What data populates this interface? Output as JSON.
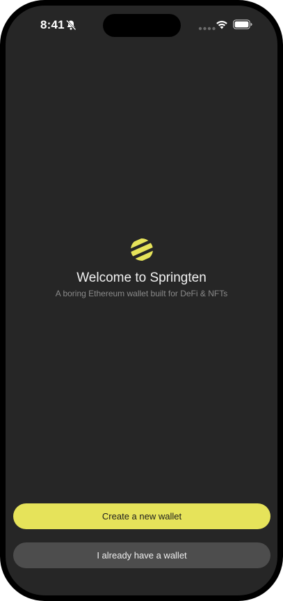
{
  "status_bar": {
    "time": "8:41",
    "icons": [
      "bell-slash-icon",
      "signal-dots-icon",
      "wifi-icon",
      "battery-icon"
    ]
  },
  "welcome": {
    "logo_icon": "springten-logo-icon",
    "title": "Welcome to Springten",
    "subtitle": "A boring Ethereum wallet built for DeFi & NFTs"
  },
  "actions": {
    "create_label": "Create a new wallet",
    "import_label": "I already have a wallet"
  },
  "colors": {
    "background": "#262626",
    "accent": "#e6e35a",
    "secondary_button": "#4d4d4d",
    "subtitle": "#8a8a8a"
  }
}
